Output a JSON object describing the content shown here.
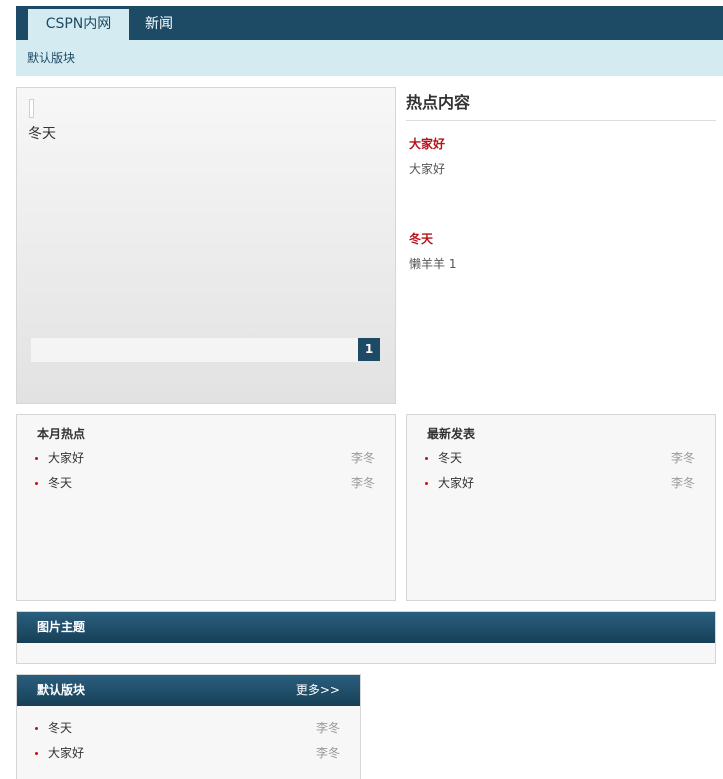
{
  "nav": {
    "tabs": [
      {
        "label": "CSPN内网"
      },
      {
        "label": "新闻"
      }
    ]
  },
  "subnav": {
    "label": "默认版块"
  },
  "slider": {
    "caption": "冬天",
    "page": "1"
  },
  "hot": {
    "title": "热点内容",
    "items": [
      {
        "title": "大家好",
        "desc": "大家好"
      },
      {
        "title": "冬天",
        "desc": "懒羊羊 1"
      }
    ]
  },
  "monthly": {
    "title": "本月热点",
    "rows": [
      {
        "text": "大家好",
        "author": "李冬"
      },
      {
        "text": "冬天",
        "author": "李冬"
      }
    ]
  },
  "latest": {
    "title": "最新发表",
    "rows": [
      {
        "text": "冬天",
        "author": "李冬"
      },
      {
        "text": "大家好",
        "author": "李冬"
      }
    ]
  },
  "gallery": {
    "title": "图片主题"
  },
  "board": {
    "title": "默认版块",
    "more": "更多>>",
    "rows": [
      {
        "text": "冬天",
        "author": "李冬"
      },
      {
        "text": "大家好",
        "author": "李冬"
      }
    ]
  }
}
